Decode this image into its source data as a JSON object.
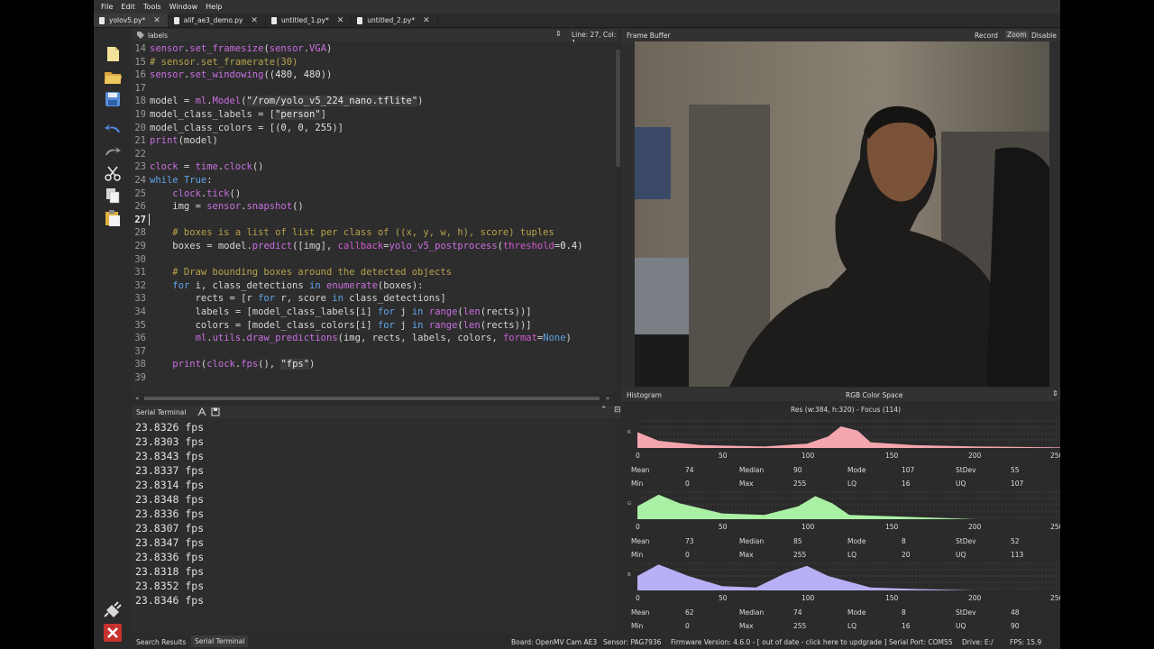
{
  "menu": [
    "File",
    "Edit",
    "Tools",
    "Window",
    "Help"
  ],
  "tabs": [
    {
      "label": "yolov5.py*",
      "active": true
    },
    {
      "label": "alif_ae3_demo.py",
      "active": false
    },
    {
      "label": "untitled_1.py*",
      "active": false
    },
    {
      "label": "untitled_2.py*",
      "active": false
    }
  ],
  "editor": {
    "header": "labels",
    "position": "Line: 27, Col: 1",
    "current_line": 27,
    "lines": [
      {
        "n": 14,
        "code": "sensor.set_framesize(sensor.VGA)"
      },
      {
        "n": 15,
        "code": "# sensor.set_framerate(30)"
      },
      {
        "n": 16,
        "code": "sensor.set_windowing((480, 480))"
      },
      {
        "n": 17,
        "code": ""
      },
      {
        "n": 18,
        "code": "model = ml.Model(\"/rom/yolo_v5_224_nano.tflite\")"
      },
      {
        "n": 19,
        "code": "model_class_labels = [\"person\"]"
      },
      {
        "n": 20,
        "code": "model_class_colors = [(0, 0, 255)]"
      },
      {
        "n": 21,
        "code": "print(model)"
      },
      {
        "n": 22,
        "code": ""
      },
      {
        "n": 23,
        "code": "clock = time.clock()"
      },
      {
        "n": 24,
        "code": "while True:"
      },
      {
        "n": 25,
        "code": "    clock.tick()"
      },
      {
        "n": 26,
        "code": "    img = sensor.snapshot()"
      },
      {
        "n": 27,
        "code": ""
      },
      {
        "n": 28,
        "code": "    # boxes is a list of list per class of ((x, y, w, h), score) tuples"
      },
      {
        "n": 29,
        "code": "    boxes = model.predict([img], callback=yolo_v5_postprocess(threshold=0.4)"
      },
      {
        "n": 30,
        "code": ""
      },
      {
        "n": 31,
        "code": "    # Draw bounding boxes around the detected objects"
      },
      {
        "n": 32,
        "code": "    for i, class_detections in enumerate(boxes):"
      },
      {
        "n": 33,
        "code": "        rects = [r for r, score in class_detections]"
      },
      {
        "n": 34,
        "code": "        labels = [model_class_labels[i] for j in range(len(rects))]"
      },
      {
        "n": 35,
        "code": "        colors = [model_class_colors[i] for j in range(len(rects))]"
      },
      {
        "n": 36,
        "code": "        ml.utils.draw_predictions(img, rects, labels, colors, format=None)"
      },
      {
        "n": 37,
        "code": ""
      },
      {
        "n": 38,
        "code": "    print(clock.fps(), \"fps\")"
      },
      {
        "n": 39,
        "code": ""
      }
    ]
  },
  "terminal": {
    "title": "Serial Terminal",
    "lines": [
      "23.8326 fps",
      "23.8303 fps",
      "23.8343 fps",
      "23.8337 fps",
      "23.8314 fps",
      "23.8348 fps",
      "23.8336 fps",
      "23.8307 fps",
      "23.8347 fps",
      "23.8336 fps",
      "23.8318 fps",
      "23.8352 fps",
      "23.8346 fps"
    ]
  },
  "status": {
    "search_tab": "Search Results",
    "serial_tab": "Serial Terminal",
    "board": "Board: OpenMV Cam AE3",
    "sensor": "Sensor: PAG7936",
    "firmware": "Firmware Version: 4.6.0 - [ out of date - click here to updgrade ]",
    "port": "Serial Port: COM55",
    "drive": "Drive: E:/",
    "fps": "FPS: 15.9"
  },
  "framebuffer": {
    "title": "Frame Buffer",
    "record": "Record",
    "zoom": "Zoom",
    "disable": "Disable"
  },
  "histogram": {
    "title": "Histogram",
    "color_space": "RGB Color Space",
    "resolution": "Res (w:384, h:320) - Focus (114)",
    "ticks": [
      "0",
      "50",
      "100",
      "150",
      "200",
      "250"
    ],
    "stat_labels": {
      "mean": "Mean",
      "median": "Median",
      "mode": "Mode",
      "stdev": "StDev",
      "min": "Min",
      "max": "Max",
      "lq": "LQ",
      "uq": "UQ"
    },
    "channels": [
      {
        "axis": "R",
        "color": "#f4a6ae",
        "mean": "74",
        "median": "90",
        "mode": "107",
        "stdev": "55",
        "min": "0",
        "max": "255",
        "lq": "16",
        "uq": "107"
      },
      {
        "axis": "G",
        "color": "#a9f0a4",
        "mean": "73",
        "median": "85",
        "mode": "8",
        "stdev": "52",
        "min": "0",
        "max": "255",
        "lq": "20",
        "uq": "113"
      },
      {
        "axis": "B",
        "color": "#b8b0f4",
        "mean": "62",
        "median": "74",
        "mode": "8",
        "stdev": "48",
        "min": "0",
        "max": "255",
        "lq": "16",
        "uq": "90"
      }
    ]
  }
}
